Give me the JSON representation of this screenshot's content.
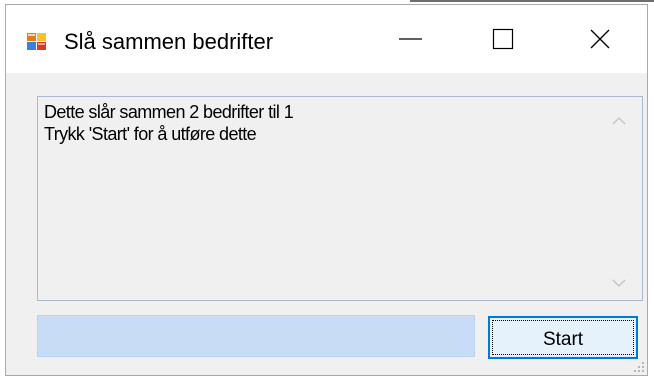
{
  "window": {
    "title": "Slå sammen bedrifter",
    "icon": "application-icon"
  },
  "caption_buttons": {
    "minimize_icon": "minimize-icon",
    "maximize_icon": "maximize-icon",
    "close_icon": "close-icon"
  },
  "message_box": {
    "lines": [
      "Dette slår sammen 2 bedrifter til 1",
      "Trykk 'Start' for å utføre dette"
    ]
  },
  "progress": {
    "value": 0
  },
  "start_button": {
    "label": "Start"
  },
  "colors": {
    "titlebar": "#ffffff",
    "window_bg": "#f0f0f0",
    "progress_fill": "#c8dcf5",
    "button_focus_border": "#0078d7",
    "button_bg": "#e5f1fb"
  }
}
